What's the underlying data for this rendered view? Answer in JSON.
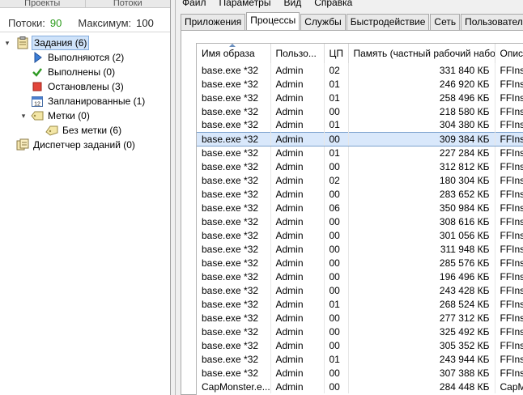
{
  "left_panel": {
    "tabs": [
      "Проекты",
      "Потоки"
    ],
    "threads_label": "Потоки:",
    "threads_value": "90",
    "max_label": "Максимум:",
    "max_value": "100",
    "tree": {
      "tasks": "Задания (6)",
      "running": "Выполняются (2)",
      "done": "Выполнены (0)",
      "stopped": "Остановлены (3)",
      "scheduled": "Запланированные (1)",
      "tags": "Метки (0)",
      "untagged": "Без метки (6)",
      "task_manager": "Диспетчер заданий (0)"
    }
  },
  "right_panel": {
    "menu": [
      "Файл",
      "Параметры",
      "Вид",
      "Справка"
    ],
    "tabs": [
      "Приложения",
      "Процессы",
      "Службы",
      "Быстродействие",
      "Сеть",
      "Пользователи"
    ],
    "active_tab": "Процессы",
    "columns": [
      "Имя образа",
      "Пользо...",
      "ЦП",
      "Память (частный рабочий набор)",
      "Описа"
    ],
    "rows": [
      [
        "base.exe *32",
        "Admin",
        "02",
        "331 840 КБ",
        "FFIns"
      ],
      [
        "base.exe *32",
        "Admin",
        "01",
        "246 920 КБ",
        "FFIns"
      ],
      [
        "base.exe *32",
        "Admin",
        "01",
        "258 496 КБ",
        "FFIns"
      ],
      [
        "base.exe *32",
        "Admin",
        "00",
        "218 580 КБ",
        "FFIns"
      ],
      [
        "base.exe *32",
        "Admin",
        "01",
        "304 380 КБ",
        "FFIns"
      ],
      [
        "base.exe *32",
        "Admin",
        "00",
        "309 384 КБ",
        "FFIns"
      ],
      [
        "base.exe *32",
        "Admin",
        "01",
        "227 284 КБ",
        "FFIns"
      ],
      [
        "base.exe *32",
        "Admin",
        "00",
        "312 812 КБ",
        "FFIns"
      ],
      [
        "base.exe *32",
        "Admin",
        "02",
        "180 304 КБ",
        "FFIns"
      ],
      [
        "base.exe *32",
        "Admin",
        "00",
        "283 652 КБ",
        "FFIns"
      ],
      [
        "base.exe *32",
        "Admin",
        "06",
        "350 984 КБ",
        "FFIns"
      ],
      [
        "base.exe *32",
        "Admin",
        "00",
        "308 616 КБ",
        "FFIns"
      ],
      [
        "base.exe *32",
        "Admin",
        "00",
        "301 056 КБ",
        "FFIns"
      ],
      [
        "base.exe *32",
        "Admin",
        "00",
        "311 948 КБ",
        "FFIns"
      ],
      [
        "base.exe *32",
        "Admin",
        "00",
        "285 576 КБ",
        "FFIns"
      ],
      [
        "base.exe *32",
        "Admin",
        "00",
        "196 496 КБ",
        "FFIns"
      ],
      [
        "base.exe *32",
        "Admin",
        "00",
        "243 428 КБ",
        "FFIns"
      ],
      [
        "base.exe *32",
        "Admin",
        "01",
        "268 524 КБ",
        "FFIns"
      ],
      [
        "base.exe *32",
        "Admin",
        "00",
        "277 312 КБ",
        "FFIns"
      ],
      [
        "base.exe *32",
        "Admin",
        "00",
        "325 492 КБ",
        "FFIns"
      ],
      [
        "base.exe *32",
        "Admin",
        "00",
        "305 352 КБ",
        "FFIns"
      ],
      [
        "base.exe *32",
        "Admin",
        "01",
        "243 944 КБ",
        "FFIns"
      ],
      [
        "base.exe *32",
        "Admin",
        "00",
        "307 388 КБ",
        "FFIns"
      ],
      [
        "CapMonster.e...",
        "Admin",
        "00",
        "284 448 КБ",
        "CapM"
      ]
    ],
    "selected_row_index": 5
  },
  "colors": {
    "threads_value": "#2a9a1a",
    "selection": "#cfe3fa"
  }
}
